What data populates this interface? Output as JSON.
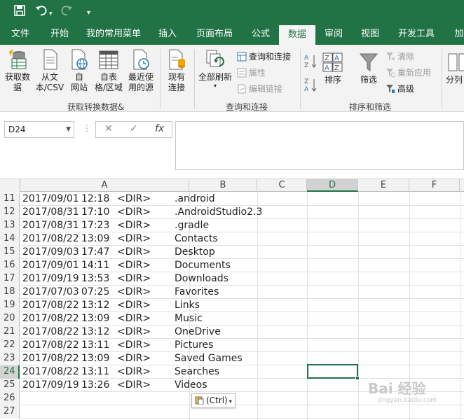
{
  "quick_access": {
    "save_icon": "save-icon",
    "undo_icon": "undo-icon",
    "redo_icon": "redo-icon",
    "customize_icon": "chevron-down-icon"
  },
  "tabs": [
    "文件",
    "开始",
    "我的常用菜单",
    "插入",
    "页面布局",
    "公式",
    "数据",
    "审阅",
    "视图",
    "开发工具",
    "加"
  ],
  "active_tab": "数据",
  "ribbon": {
    "get_data": {
      "label1": "获取数",
      "label2": "据"
    },
    "from_text": {
      "label1": "从文",
      "label2": "本/CSV"
    },
    "from_web": {
      "label1": "自",
      "label2": "网站"
    },
    "from_table": {
      "label1": "自表",
      "label2": "格/区域"
    },
    "recent_sources": {
      "label1": "最近使",
      "label2": "用的源"
    },
    "existing_conn": {
      "label1": "现有",
      "label2": "连接"
    },
    "group_get_label": "获取转换数据&",
    "refresh_all": {
      "label": "全部刷新"
    },
    "queries_conn": "查询和连接",
    "properties": "属性",
    "edit_links": "编辑链接",
    "group_queries_label": "查询和连接",
    "sort": "排序",
    "filter": "筛选",
    "clear": "清除",
    "reapply": "重新应用",
    "advanced": "高级",
    "group_sort_label": "排序和筛选",
    "split": "分列"
  },
  "formula_bar": {
    "name_box": "D24",
    "cancel": "✕",
    "enter": "✓",
    "fx": "fx",
    "value": ""
  },
  "columns": [
    "A",
    "B",
    "C",
    "D",
    "E",
    "F"
  ],
  "selected_col": "D",
  "rows": [
    {
      "n": "11",
      "date": "2017/09/01",
      "time": "12:18",
      "dir": "<DIR>",
      "name": ".android"
    },
    {
      "n": "12",
      "date": "2017/08/31",
      "time": "17:10",
      "dir": "<DIR>",
      "name": ".AndroidStudio2.3"
    },
    {
      "n": "13",
      "date": "2017/08/31",
      "time": "17:23",
      "dir": "<DIR>",
      "name": ".gradle"
    },
    {
      "n": "14",
      "date": "2017/08/22",
      "time": "13:09",
      "dir": "<DIR>",
      "name": "Contacts"
    },
    {
      "n": "15",
      "date": "2017/09/03",
      "time": "17:47",
      "dir": "<DIR>",
      "name": "Desktop"
    },
    {
      "n": "16",
      "date": "2017/09/01",
      "time": "14:11",
      "dir": "<DIR>",
      "name": "Documents"
    },
    {
      "n": "17",
      "date": "2017/09/19",
      "time": "13:53",
      "dir": "<DIR>",
      "name": "Downloads"
    },
    {
      "n": "18",
      "date": "2017/07/03",
      "time": "07:25",
      "dir": "<DIR>",
      "name": "Favorites"
    },
    {
      "n": "19",
      "date": "2017/08/22",
      "time": "13:12",
      "dir": "<DIR>",
      "name": "Links"
    },
    {
      "n": "20",
      "date": "2017/08/22",
      "time": "13:09",
      "dir": "<DIR>",
      "name": "Music"
    },
    {
      "n": "21",
      "date": "2017/08/22",
      "time": "13:12",
      "dir": "<DIR>",
      "name": "OneDrive"
    },
    {
      "n": "22",
      "date": "2017/08/22",
      "time": "13:11",
      "dir": "<DIR>",
      "name": "Pictures"
    },
    {
      "n": "23",
      "date": "2017/08/22",
      "time": "13:09",
      "dir": "<DIR>",
      "name": "Saved Games"
    },
    {
      "n": "24",
      "date": "2017/08/22",
      "time": "13:11",
      "dir": "<DIR>",
      "name": "Searches"
    },
    {
      "n": "25",
      "date": "2017/09/19",
      "time": "13:26",
      "dir": "<DIR>",
      "name": "Videos"
    },
    {
      "n": "26",
      "date": "",
      "time": "",
      "dir": "",
      "name": ""
    },
    {
      "n": "27",
      "date": "",
      "time": "",
      "dir": "",
      "name": ""
    }
  ],
  "selected_row": "24",
  "paste_options": "(Ctrl)",
  "watermark": {
    "text": "Bai 经验",
    "sub": "jingyan.baidu.com"
  },
  "colors": {
    "excel_green": "#217346",
    "ribbon_bg": "#f3f3f3"
  }
}
